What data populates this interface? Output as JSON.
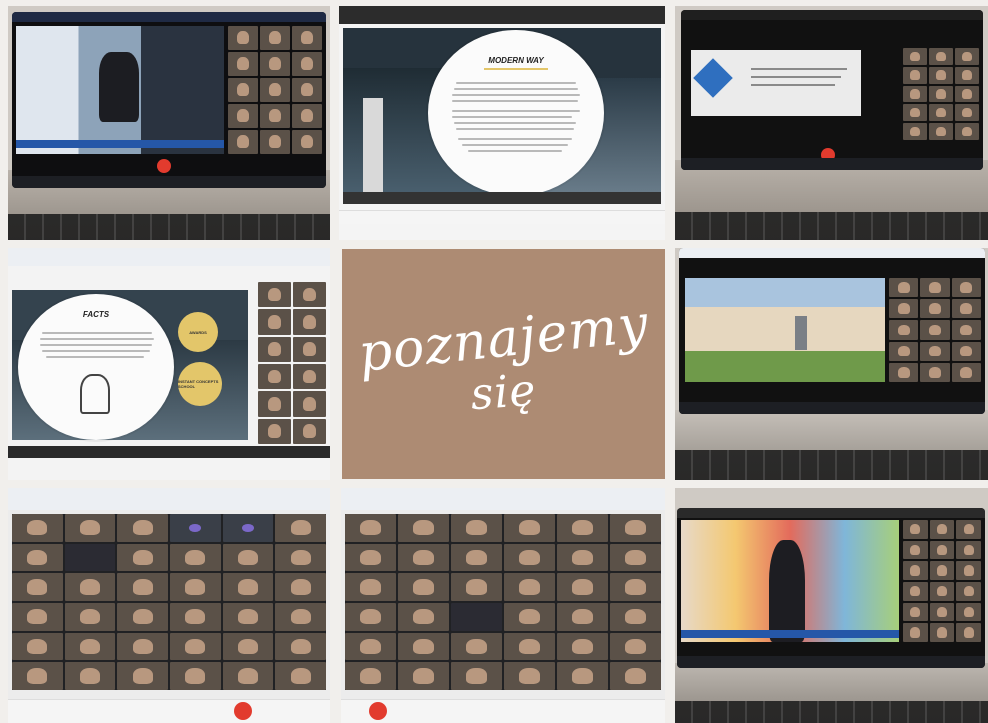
{
  "center": {
    "line1": "poznajemy",
    "line2": "się",
    "background": "#ad8b73"
  },
  "slides": {
    "modern_way": "MODERN WAY",
    "facts": "FACTS",
    "yellow1": "AWARDS",
    "yellow2": "INSTANT CONCEPTS SCHOOL"
  },
  "colors": {
    "end_call": "#e23b2e",
    "meet_banner": "#2557a8",
    "accent_yellow": "#e3c66a"
  }
}
